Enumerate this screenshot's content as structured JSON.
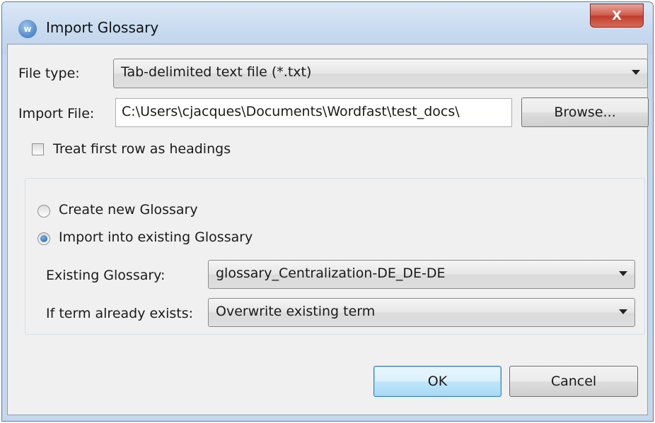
{
  "window": {
    "title": "Import Glossary",
    "app_icon_glyph": "w",
    "close_glyph": "X"
  },
  "file_type": {
    "label": "File type:",
    "selected": "Tab-delimited text file (*.txt)"
  },
  "import_file": {
    "label": "Import File:",
    "value": "C:\\Users\\cjacques\\Documents\\Wordfast\\test_docs\\",
    "browse_label": "Browse..."
  },
  "options": {
    "treat_first_row_label": "Treat first row as headings",
    "treat_first_row_checked": false
  },
  "mode": {
    "create_new_label": "Create new Glossary",
    "import_existing_label": "Import into existing Glossary",
    "selected": "import_existing"
  },
  "existing_glossary": {
    "label": "Existing Glossary:",
    "selected": "glossary_Centralization-DE_DE-DE"
  },
  "term_exists": {
    "label": "If term already exists:",
    "selected": "Overwrite existing term"
  },
  "buttons": {
    "ok_label": "OK",
    "cancel_label": "Cancel"
  },
  "colors": {
    "title_bar": "#c4d7ec",
    "client_bg": "#f0f0f0",
    "close_button": "#c84a3a",
    "default_button": "#bee6fd"
  }
}
